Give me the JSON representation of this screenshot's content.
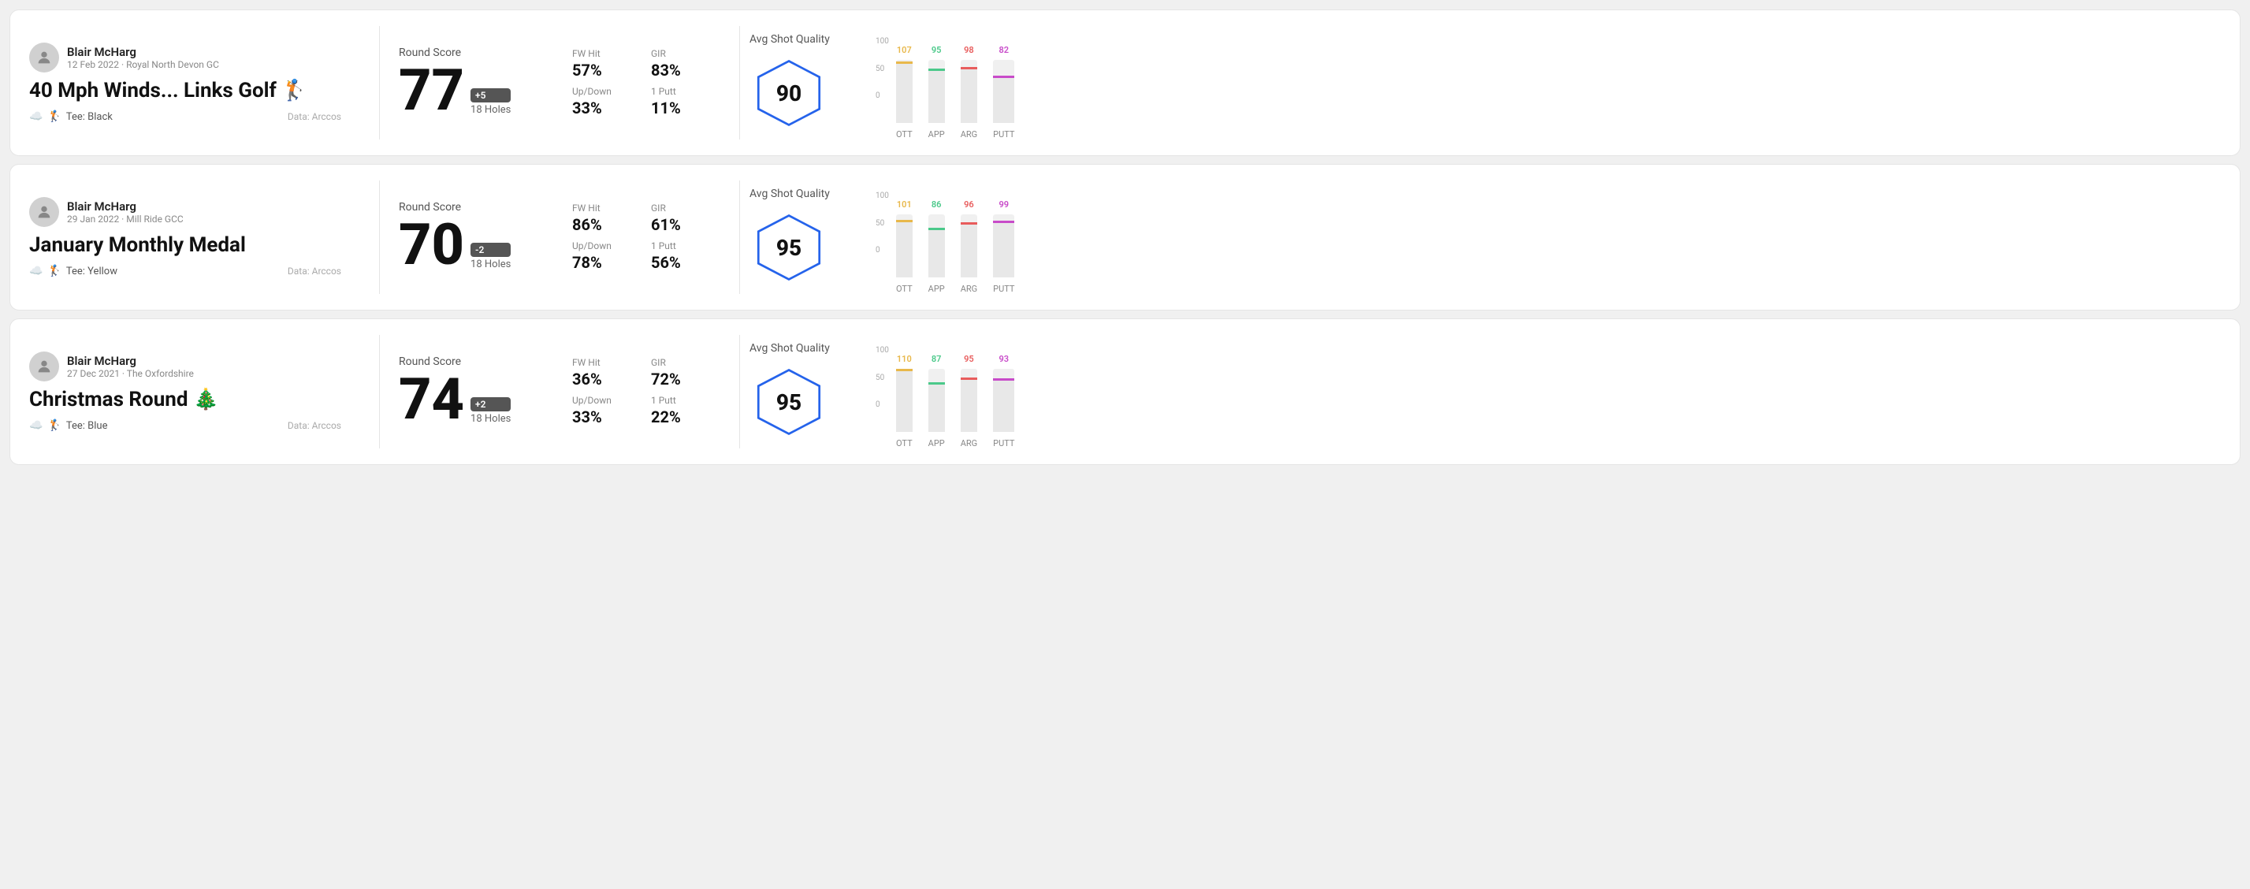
{
  "rounds": [
    {
      "id": "round1",
      "user": {
        "name": "Blair McHarg",
        "date": "12 Feb 2022 · Royal North Devon GC"
      },
      "title": "40 Mph Winds... Links Golf 🏌️",
      "titleEmoji": "🏌️",
      "tee": "Black",
      "dataSource": "Data: Arccos",
      "score": {
        "value": "77",
        "badge": "+5",
        "holes": "18 Holes"
      },
      "stats": {
        "fwHit": "57%",
        "gir": "83%",
        "upDown": "33%",
        "onePutt": "11%"
      },
      "quality": {
        "score": "90",
        "label": "Avg Shot Quality"
      },
      "chart": {
        "bars": [
          {
            "label": "OTT",
            "value": 107,
            "color": "#e8b84b",
            "barColor": "#e0e0e0"
          },
          {
            "label": "APP",
            "value": 95,
            "color": "#4bc98a",
            "barColor": "#e0e0e0"
          },
          {
            "label": "ARG",
            "value": 98,
            "color": "#e85c5c",
            "barColor": "#e0e0e0"
          },
          {
            "label": "PUTT",
            "value": 82,
            "color": "#c84bc9",
            "barColor": "#e0e0e0"
          }
        ],
        "yMax": 100,
        "yMid": 50,
        "yMin": 0
      }
    },
    {
      "id": "round2",
      "user": {
        "name": "Blair McHarg",
        "date": "29 Jan 2022 · Mill Ride GCC"
      },
      "title": "January Monthly Medal",
      "titleEmoji": "",
      "tee": "Yellow",
      "dataSource": "Data: Arccos",
      "score": {
        "value": "70",
        "badge": "-2",
        "holes": "18 Holes"
      },
      "stats": {
        "fwHit": "86%",
        "gir": "61%",
        "upDown": "78%",
        "onePutt": "56%"
      },
      "quality": {
        "score": "95",
        "label": "Avg Shot Quality"
      },
      "chart": {
        "bars": [
          {
            "label": "OTT",
            "value": 101,
            "color": "#e8b84b",
            "barColor": "#e0e0e0"
          },
          {
            "label": "APP",
            "value": 86,
            "color": "#4bc98a",
            "barColor": "#e0e0e0"
          },
          {
            "label": "ARG",
            "value": 96,
            "color": "#e85c5c",
            "barColor": "#e0e0e0"
          },
          {
            "label": "PUTT",
            "value": 99,
            "color": "#c84bc9",
            "barColor": "#e0e0e0"
          }
        ],
        "yMax": 100,
        "yMid": 50,
        "yMin": 0
      }
    },
    {
      "id": "round3",
      "user": {
        "name": "Blair McHarg",
        "date": "27 Dec 2021 · The Oxfordshire"
      },
      "title": "Christmas Round 🎄",
      "titleEmoji": "🎄",
      "tee": "Blue",
      "dataSource": "Data: Arccos",
      "score": {
        "value": "74",
        "badge": "+2",
        "holes": "18 Holes"
      },
      "stats": {
        "fwHit": "36%",
        "gir": "72%",
        "upDown": "33%",
        "onePutt": "22%"
      },
      "quality": {
        "score": "95",
        "label": "Avg Shot Quality"
      },
      "chart": {
        "bars": [
          {
            "label": "OTT",
            "value": 110,
            "color": "#e8b84b",
            "barColor": "#e0e0e0"
          },
          {
            "label": "APP",
            "value": 87,
            "color": "#4bc98a",
            "barColor": "#e0e0e0"
          },
          {
            "label": "ARG",
            "value": 95,
            "color": "#e85c5c",
            "barColor": "#e0e0e0"
          },
          {
            "label": "PUTT",
            "value": 93,
            "color": "#c84bc9",
            "barColor": "#e0e0e0"
          }
        ],
        "yMax": 100,
        "yMid": 50,
        "yMin": 0
      }
    }
  ],
  "labels": {
    "roundScore": "Round Score",
    "avgShotQuality": "Avg Shot Quality",
    "fwHit": "FW Hit",
    "gir": "GIR",
    "upDown": "Up/Down",
    "onePutt": "1 Putt",
    "data": "Data: Arccos",
    "tee": "Tee:"
  }
}
